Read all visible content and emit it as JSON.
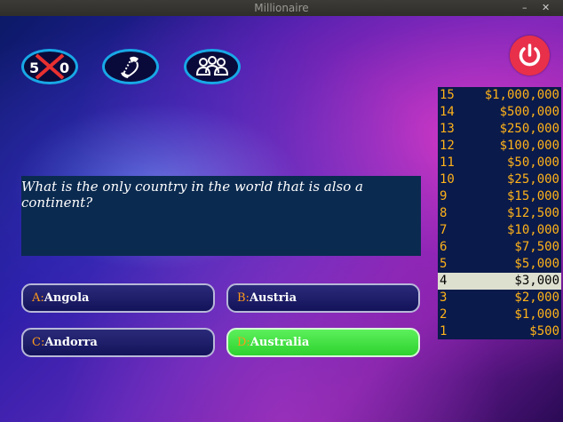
{
  "window": {
    "title": "Millionaire",
    "minimize": "–",
    "close": "✕"
  },
  "lifelines": [
    {
      "name": "fifty-fifty",
      "label_left": "5",
      "label_right": "0"
    },
    {
      "name": "phone-a-friend"
    },
    {
      "name": "ask-the-audience"
    }
  ],
  "question": {
    "text": "What is the only country in the world that is also a continent?"
  },
  "answers": [
    {
      "letter": "A:",
      "text": "Angola"
    },
    {
      "letter": "B:",
      "text": "Austria"
    },
    {
      "letter": "C:",
      "text": "Andorra"
    },
    {
      "letter": "D:",
      "text": "Australia",
      "state": "correct"
    }
  ],
  "money_ladder": [
    {
      "level": "15",
      "amount": "$1,000,000"
    },
    {
      "level": "14",
      "amount": "$500,000"
    },
    {
      "level": "13",
      "amount": "$250,000"
    },
    {
      "level": "12",
      "amount": "$100,000"
    },
    {
      "level": "11",
      "amount": "$50,000"
    },
    {
      "level": "10",
      "amount": "$25,000"
    },
    {
      "level": "9",
      "amount": "$15,000"
    },
    {
      "level": "8",
      "amount": "$12,500"
    },
    {
      "level": "7",
      "amount": "$10,000"
    },
    {
      "level": "6",
      "amount": "$7,500"
    },
    {
      "level": "5",
      "amount": "$5,000"
    },
    {
      "level": "4",
      "amount": "$3,000",
      "current": true
    },
    {
      "level": "3",
      "amount": "$2,000"
    },
    {
      "level": "2",
      "amount": "$1,000"
    },
    {
      "level": "1",
      "amount": "$500"
    }
  ],
  "colors": {
    "accent": "#18a8e6",
    "money": "#ffb21a",
    "correct": "#3ee23e",
    "power": "#e8304a"
  }
}
